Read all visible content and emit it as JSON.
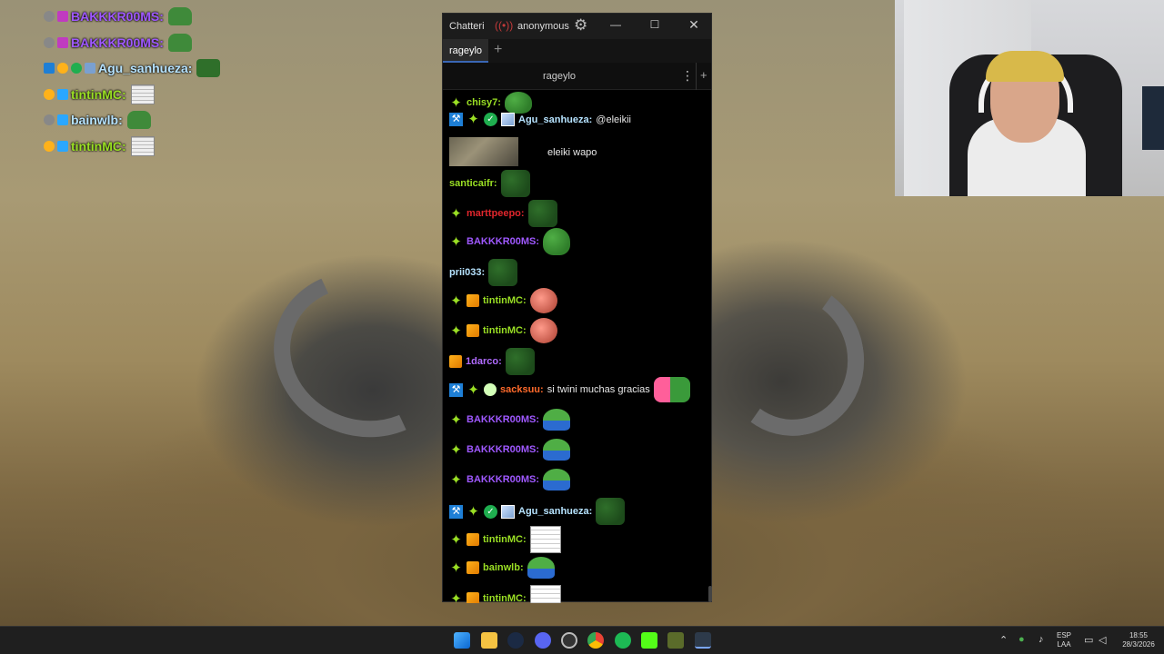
{
  "window": {
    "title": "Chatteri",
    "live_icon": "((•))",
    "account": "anonymous",
    "settings_icon": "⚙",
    "minimize_icon": "—",
    "maximize_icon": "☐",
    "close_icon": "✕"
  },
  "tabs": [
    {
      "label": "rageylo"
    }
  ],
  "tab_add": "+",
  "channel": {
    "name": "rageylo",
    "menu": "⋮",
    "add": "+"
  },
  "messages": [
    {
      "user": "chisy7:",
      "color": "#9adf24",
      "text": ""
    },
    {
      "user": "Agu_sanhueza:",
      "color": "#b6e3ff",
      "text": "@eleikii"
    },
    {
      "text2": "eleiki wapo"
    },
    {
      "user": "santicaifr:",
      "color": "#9adf24",
      "text": ""
    },
    {
      "user": "marttpeepo:",
      "color": "#e0262c",
      "text": ""
    },
    {
      "user": "BAKKKR00MS:",
      "color": "#9f58ff",
      "text": ""
    },
    {
      "user": "prii033:",
      "color": "#b6e3ff",
      "text": ""
    },
    {
      "user": "tintinMC:",
      "color": "#9adf24",
      "text": ""
    },
    {
      "user": "tintinMC:",
      "color": "#9adf24",
      "text": ""
    },
    {
      "user": "1darco:",
      "color": "#b06bff",
      "text": ""
    },
    {
      "user": "sacksuu:",
      "color": "#ff6a2b",
      "text": "si twini muchas gracias"
    },
    {
      "user": "BAKKKR00MS:",
      "color": "#9f58ff",
      "text": ""
    },
    {
      "user": "BAKKKR00MS:",
      "color": "#9f58ff",
      "text": ""
    },
    {
      "user": "BAKKKR00MS:",
      "color": "#9f58ff",
      "text": ""
    },
    {
      "user": "Agu_sanhueza:",
      "color": "#b6e3ff",
      "text": ""
    },
    {
      "user": "tintinMC:",
      "color": "#9adf24",
      "text": ""
    },
    {
      "user": "bainwlb:",
      "color": "#9adf24",
      "text": ""
    },
    {
      "user": "tintinMC:",
      "color": "#9adf24",
      "text": ""
    }
  ],
  "overlay": [
    {
      "user": "BAKKKR00MS:",
      "color": "#9f58ff"
    },
    {
      "user": "BAKKKR00MS:",
      "color": "#9f58ff"
    },
    {
      "user": "Agu_sanhueza:",
      "color": "#b6e3ff"
    },
    {
      "user": "tintinMC:",
      "color": "#9adf24"
    },
    {
      "user": "bainwlb:",
      "color": "#b6e3ff"
    },
    {
      "user": "tintinMC:",
      "color": "#9adf24"
    }
  ],
  "tray": {
    "lang_line1": "ESP",
    "lang_line2": "LAA",
    "time": "18:55",
    "date": "28/3/2026"
  }
}
